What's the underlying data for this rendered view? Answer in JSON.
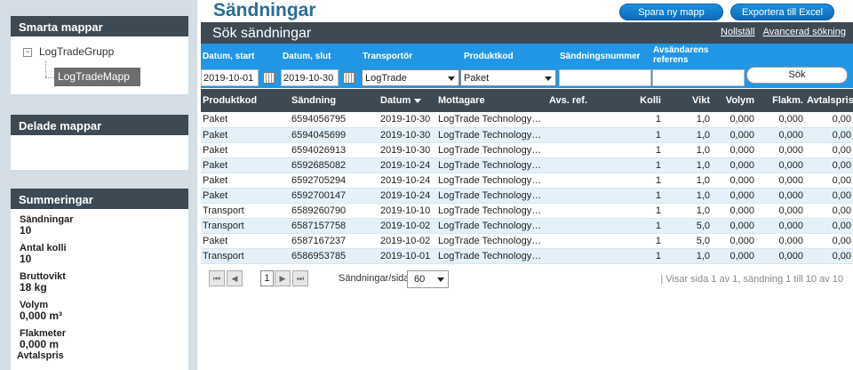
{
  "sidebar": {
    "smart_folders": {
      "title": "Smarta mappar",
      "toggle": "−",
      "root": "LogTradeGrupp",
      "child": "LogTradeMapp"
    },
    "shared_folders": {
      "title": "Delade mappar"
    },
    "summary": {
      "title": "Summeringar",
      "items": [
        {
          "label": "Sändningar",
          "value": "10"
        },
        {
          "label": "Antal kolli",
          "value": "10"
        },
        {
          "label": "Bruttovikt",
          "value": "18 kg"
        },
        {
          "label": "Volym",
          "value": "0,000 m³"
        },
        {
          "label": "Flakmeter",
          "value": "0,000 m"
        }
      ],
      "last_label": "Avtalspris"
    }
  },
  "header": {
    "title": "Sändningar",
    "save_button": "Spara ny mapp",
    "export_button": "Exportera till Excel"
  },
  "search": {
    "title": "Sök sändningar",
    "reset_link": "Nollställ",
    "advanced_link": "Avancerad sökning",
    "labels": {
      "date_start": "Datum, start",
      "date_end": "Datum, slut",
      "carrier": "Transportör",
      "product_code": "Produktkod",
      "shipment_number": "Sändningsnummer",
      "sender_ref_1": "Avsändarens",
      "sender_ref_2": "referens"
    },
    "values": {
      "date_start": "2019-10-01",
      "date_end": "2019-10-30",
      "carrier": "LogTrade",
      "product_code": "Paket",
      "shipment_number": "",
      "sender_ref": ""
    },
    "submit": "Sök"
  },
  "table": {
    "columns": {
      "product": "Produktkod",
      "shipment": "Sändning",
      "date": "Datum",
      "recipient": "Mottagare",
      "ref": "Avs. ref.",
      "packages": "Kolli",
      "weight": "Vikt",
      "volume": "Volym",
      "flak": "Flakm.",
      "price": "Avtalspris"
    },
    "rows": [
      {
        "product": "Paket",
        "shipment": "6594056795",
        "date": "2019-10-30",
        "recipient": "LogTrade Technology…",
        "ref": "",
        "packages": "1",
        "weight": "1,0",
        "volume": "0,000",
        "flak": "0,000",
        "price": "0,00"
      },
      {
        "product": "Paket",
        "shipment": "6594045699",
        "date": "2019-10-30",
        "recipient": "LogTrade Technology…",
        "ref": "",
        "packages": "1",
        "weight": "1,0",
        "volume": "0,000",
        "flak": "0,000",
        "price": "0,00"
      },
      {
        "product": "Paket",
        "shipment": "6594026913",
        "date": "2019-10-30",
        "recipient": "LogTrade Technology…",
        "ref": "",
        "packages": "1",
        "weight": "1,0",
        "volume": "0,000",
        "flak": "0,000",
        "price": "0,00"
      },
      {
        "product": "Paket",
        "shipment": "6592685082",
        "date": "2019-10-24",
        "recipient": "LogTrade Technology…",
        "ref": "",
        "packages": "1",
        "weight": "1,0",
        "volume": "0,000",
        "flak": "0,000",
        "price": "0,00"
      },
      {
        "product": "Paket",
        "shipment": "6592705294",
        "date": "2019-10-24",
        "recipient": "LogTrade Technology…",
        "ref": "",
        "packages": "1",
        "weight": "1,0",
        "volume": "0,000",
        "flak": "0,000",
        "price": "0,00"
      },
      {
        "product": "Paket",
        "shipment": "6592700147",
        "date": "2019-10-24",
        "recipient": "LogTrade Technology…",
        "ref": "",
        "packages": "1",
        "weight": "1,0",
        "volume": "0,000",
        "flak": "0,000",
        "price": "0,00"
      },
      {
        "product": "Transport",
        "shipment": "6589260790",
        "date": "2019-10-10",
        "recipient": "LogTrade Technology…",
        "ref": "",
        "packages": "1",
        "weight": "1,0",
        "volume": "0,000",
        "flak": "0,000",
        "price": "0,00"
      },
      {
        "product": "Transport",
        "shipment": "6587157758",
        "date": "2019-10-02",
        "recipient": "LogTrade Technology…",
        "ref": "",
        "packages": "1",
        "weight": "5,0",
        "volume": "0,000",
        "flak": "0,000",
        "price": "0,00"
      },
      {
        "product": "Paket",
        "shipment": "6587167237",
        "date": "2019-10-02",
        "recipient": "LogTrade Technology…",
        "ref": "",
        "packages": "1",
        "weight": "5,0",
        "volume": "0,000",
        "flak": "0,000",
        "price": "0,00"
      },
      {
        "product": "Transport",
        "shipment": "6586953785",
        "date": "2019-10-01",
        "recipient": "LogTrade Technology…",
        "ref": "",
        "packages": "1",
        "weight": "1,0",
        "volume": "0,000",
        "flak": "0,000",
        "price": "0,00"
      }
    ]
  },
  "pager": {
    "first": "⏮",
    "prev": "◀",
    "current_page": "1",
    "next": "▶",
    "last": "⏭",
    "per_page_label": "Sändningar/sida",
    "per_page_value": "60",
    "info": "| Visar sida 1 av 1, sändning 1 till 10 av 10"
  },
  "colors": {
    "header_dark": "#3d4a54",
    "filter_blue": "#2196e5",
    "title_blue": "#2a6d96",
    "sidebar_bg": "#d3dde3"
  }
}
